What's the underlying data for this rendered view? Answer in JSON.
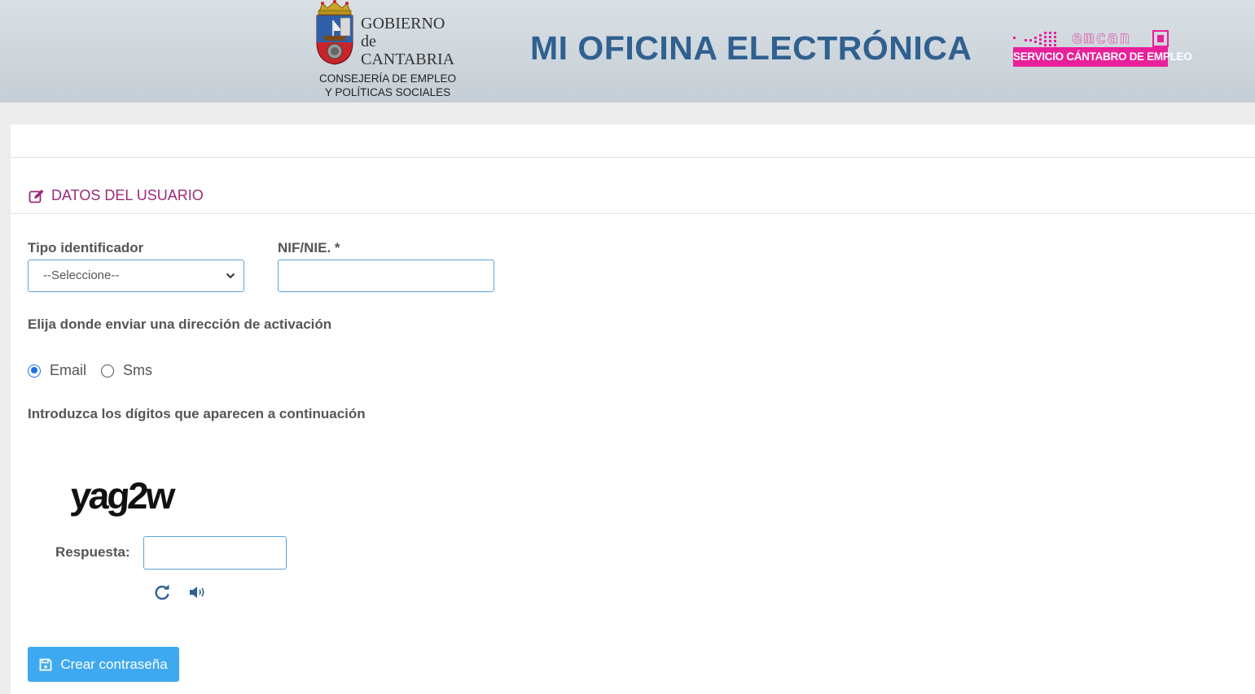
{
  "header": {
    "gov_name_lines": [
      "GOBIERNO",
      "de",
      "CANTABRIA"
    ],
    "gov_dept_lines": [
      "CONSEJERÍA DE EMPLEO",
      "Y POLÍTICAS SOCIALES"
    ],
    "site_title": "MI OFICINA ELECTRÓNICA",
    "emcan_word": "emcan",
    "emcan_tagline": "SERVICIO CÁNTABRO DE EMPLEO"
  },
  "form": {
    "section_title": "DATOS DEL USUARIO",
    "section_icon": "edit-icon",
    "tipo_label": "Tipo identificador",
    "tipo_selected": "--Seleccione--",
    "nif_label": "NIF/NIE. *",
    "nif_value": "",
    "send_label": "Elija donde enviar una dirección de activación",
    "radio_email": "Email",
    "radio_sms": "Sms",
    "radio_selected": "Email",
    "captcha_label": "Introduzca los dígitos que aparecen a continuación",
    "captcha_text": "yag2w",
    "respuesta_label": "Respuesta:",
    "respuesta_value": "",
    "submit_label": "Crear contraseña",
    "submit_icon": "save-icon",
    "refresh_icon": "refresh-icon",
    "audio_icon": "speaker-icon"
  },
  "colors": {
    "brand_blue": "#2f6090",
    "section_purple": "#9c2a79",
    "emcan_pink": "#e8209a",
    "button_blue": "#3ea9f0",
    "input_border": "#5ba3d9"
  }
}
